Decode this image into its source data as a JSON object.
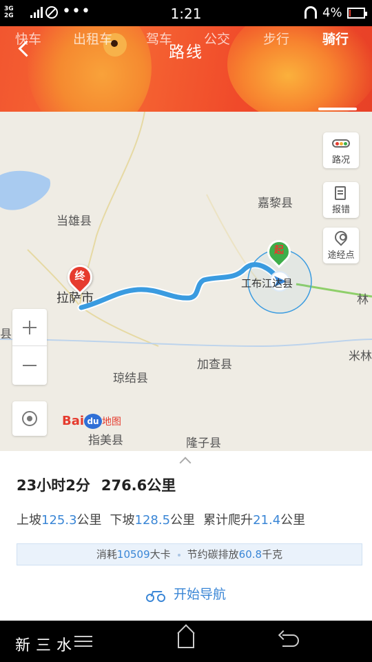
{
  "status_bar": {
    "network": "3G\n2G",
    "dots": "•••",
    "time": "1:21",
    "battery": "4%"
  },
  "header": {
    "title": "路线",
    "tabs": [
      {
        "label": "快车"
      },
      {
        "label": "出租车"
      },
      {
        "label": "驾车"
      },
      {
        "label": "公交"
      },
      {
        "label": "步行"
      },
      {
        "label": "骑行",
        "active": true
      }
    ]
  },
  "map": {
    "labels": {
      "dangxiong": "当雄县",
      "jiali": "嘉黎县",
      "lhasa": "拉萨市",
      "nyingchi": "林",
      "county_left": "县",
      "gongbo": "工布江达县",
      "jiacha": "加查县",
      "mila": "米林",
      "qiongjie": "琼结县",
      "zhinan": "指美县",
      "longzi": "隆子县"
    },
    "controls": {
      "traffic": "路况",
      "report": "报错",
      "waypoint": "途经点"
    },
    "end_marker": "终",
    "start_marker": "起",
    "logo": {
      "bai": "Bai",
      "du": "du",
      "tu": "地图"
    },
    "colors": {
      "route": "#3a9be0",
      "end": "#e63b2e",
      "start": "#3dae4a"
    }
  },
  "route": {
    "duration": "23小时2分",
    "distance": "276.6公里",
    "uphill_label": "上坡",
    "uphill_value": "125.3",
    "uphill_unit": "公里",
    "downhill_label": "下坡",
    "downhill_value": "128.5",
    "downhill_unit": "公里",
    "climb_label": "累计爬升",
    "climb_value": "21.4",
    "climb_unit": "公里",
    "calorie_label": "消耗",
    "calorie_value": "10509",
    "calorie_unit": "大卡",
    "carbon_label": "节约碳排放",
    "carbon_value": "60.8",
    "carbon_unit": "千克",
    "navigate_label": "开始导航"
  },
  "watermark": "新三水"
}
